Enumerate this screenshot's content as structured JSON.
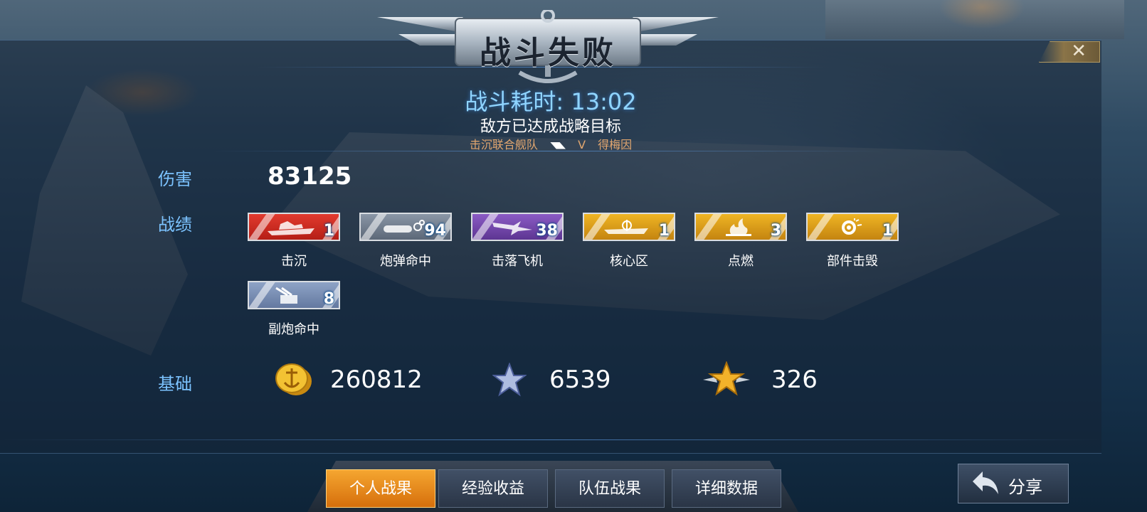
{
  "header": {
    "title": "战斗失败"
  },
  "summary": {
    "battle_time": "战斗耗时: 13:02",
    "reason": "敌方已达成战略目标",
    "fleet_left": "击沉联合舰队",
    "vs": "V",
    "fleet_right": "得梅因"
  },
  "damage": {
    "label": "伤害",
    "value": "83125"
  },
  "record": {
    "label": "战绩",
    "items": [
      {
        "name": "击沉",
        "count": "1",
        "color": "#d42c22",
        "icon": "ship-icon"
      },
      {
        "name": "炮弹命中",
        "count": "94",
        "color": "#6e7b8c",
        "icon": "shell-icon"
      },
      {
        "name": "击落飞机",
        "count": "38",
        "color": "#734aa8",
        "icon": "plane-icon"
      },
      {
        "name": "核心区",
        "count": "1",
        "color": "#d99a16",
        "icon": "core-icon"
      },
      {
        "name": "点燃",
        "count": "3",
        "color": "#d99a16",
        "icon": "fire-icon"
      },
      {
        "name": "部件击毁",
        "count": "1",
        "color": "#d99a16",
        "icon": "gear-icon"
      },
      {
        "name": "副炮命中",
        "count": "8",
        "color": "#778db3",
        "icon": "turret-icon"
      }
    ]
  },
  "basic": {
    "label": "基础",
    "coins": "260812",
    "exp": "6539",
    "merit": "326"
  },
  "tabs": [
    "个人战果",
    "经验收益",
    "队伍战果",
    "详细数据"
  ],
  "share": "分享"
}
